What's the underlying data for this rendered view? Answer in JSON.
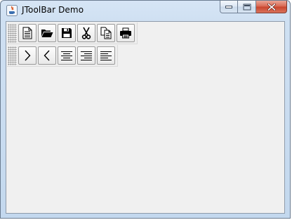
{
  "window": {
    "title": "JToolBar Demo",
    "icon": "java-icon"
  },
  "toolbars": [
    {
      "buttons": [
        {
          "name": "new-document-button",
          "icon": "document-icon"
        },
        {
          "name": "open-button",
          "icon": "folder-open-icon"
        },
        {
          "name": "save-button",
          "icon": "floppy-disk-icon"
        },
        {
          "name": "cut-button",
          "icon": "scissors-icon"
        },
        {
          "name": "copy-button",
          "icon": "copy-icon"
        },
        {
          "name": "print-button",
          "icon": "printer-icon"
        }
      ]
    },
    {
      "buttons": [
        {
          "name": "next-button",
          "icon": "chevron-right-icon"
        },
        {
          "name": "previous-button",
          "icon": "chevron-left-icon"
        },
        {
          "name": "align-center-button",
          "icon": "align-center-icon"
        },
        {
          "name": "align-right-button",
          "icon": "align-right-icon"
        },
        {
          "name": "align-left-button",
          "icon": "align-left-icon"
        }
      ]
    }
  ]
}
